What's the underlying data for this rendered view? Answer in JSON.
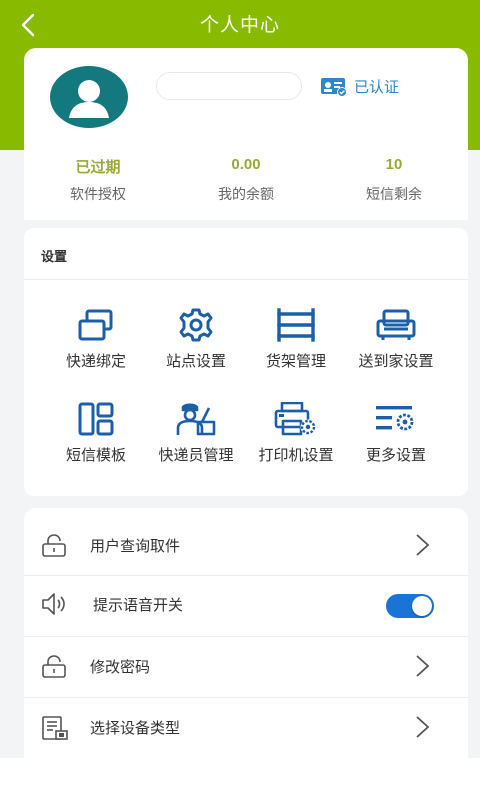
{
  "header": {
    "title": "个人中心",
    "bg_color": "#88bb00"
  },
  "profile": {
    "verified_label": "已认证",
    "stats": [
      {
        "value": "已过期",
        "label": "软件授权"
      },
      {
        "value": "0.00",
        "label": "我的余额"
      },
      {
        "value": "10",
        "label": "短信剩余"
      }
    ]
  },
  "settings": {
    "title": "设置",
    "items": [
      {
        "label": "快递绑定",
        "icon": "link-boxes-icon"
      },
      {
        "label": "站点设置",
        "icon": "gear-icon"
      },
      {
        "label": "货架管理",
        "icon": "shelf-icon"
      },
      {
        "label": "送到家设置",
        "icon": "sofa-icon"
      },
      {
        "label": "短信模板",
        "icon": "template-icon"
      },
      {
        "label": "快递员管理",
        "icon": "courier-icon"
      },
      {
        "label": "打印机设置",
        "icon": "printer-gear-icon"
      },
      {
        "label": "更多设置",
        "icon": "more-settings-icon"
      }
    ]
  },
  "list": {
    "items": [
      {
        "label": "用户查询取件",
        "icon": "lock-icon",
        "type": "link"
      },
      {
        "label": "提示语音开关",
        "icon": "speaker-icon",
        "type": "toggle",
        "on": true
      },
      {
        "label": "修改密码",
        "icon": "lock-icon",
        "type": "link"
      },
      {
        "label": "选择设备类型",
        "icon": "device-list-icon",
        "type": "link"
      }
    ]
  },
  "colors": {
    "accent_green": "#88bb00",
    "icon_blue": "#1c5fa8",
    "toggle_blue": "#1c73d6",
    "stat_yellow": "#9aa93a"
  }
}
